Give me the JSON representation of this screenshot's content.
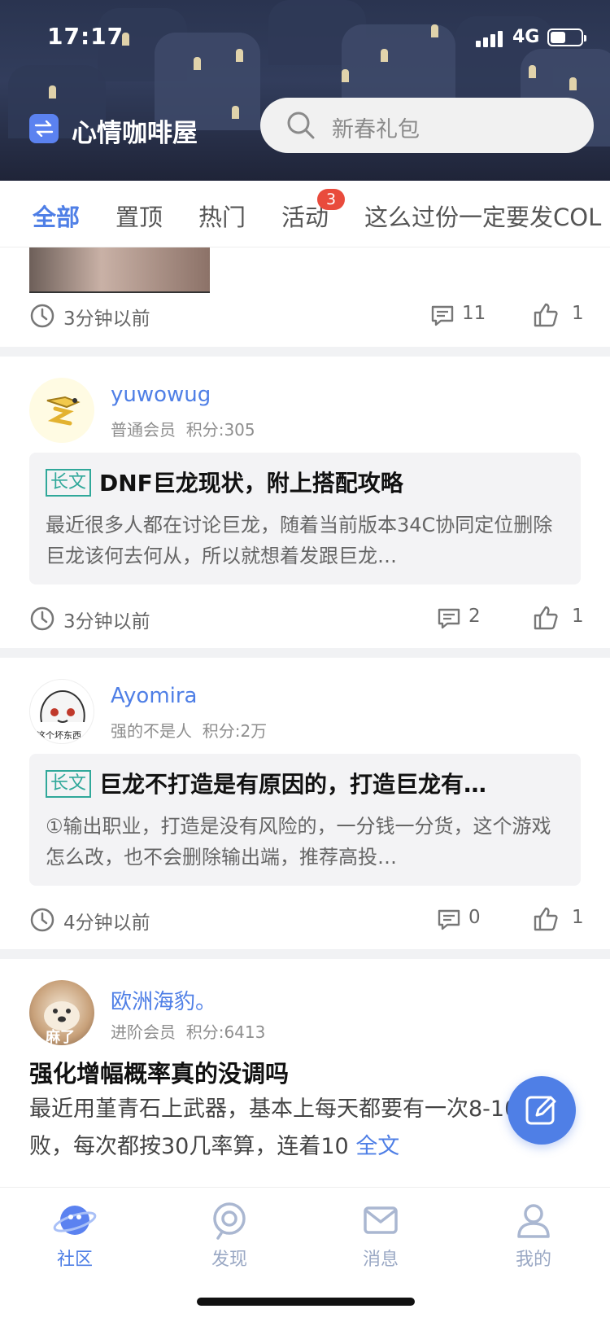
{
  "status_bar": {
    "time": "17:17",
    "network": "4G"
  },
  "header": {
    "app_title": "心情咖啡屋",
    "search_placeholder": "新春礼包",
    "logo_icon": "swap-arrows-icon"
  },
  "tabs": [
    {
      "label": "全部",
      "active": true
    },
    {
      "label": "置顶"
    },
    {
      "label": "热门"
    },
    {
      "label": "活动",
      "badge": "3"
    },
    {
      "label": "这么过份一定要发COL"
    }
  ],
  "posts": [
    {
      "time": "3分钟以前",
      "comments": "11",
      "likes": "1"
    },
    {
      "username": "yuwowug",
      "rank": "普通会员",
      "points": "积分:305",
      "tag": "长文",
      "title": "DNF巨龙现状，附上搭配攻略",
      "body": "最近很多人都在讨论巨龙，随着当前版本34C协同定位删除巨龙该何去何从，所以就想着发跟巨龙…",
      "time": "3分钟以前",
      "comments": "2",
      "likes": "1"
    },
    {
      "username": "Ayomira",
      "rank": "强的不是人",
      "points": "积分:2万",
      "avatar_caption": "这个坏东西",
      "tag": "长文",
      "title": "巨龙不打造是有原因的，打造巨龙有…",
      "body": "①输出职业，打造是没有风险的，一分钱一分货，这个游戏怎么改，也不会删除输出端，推荐高投…",
      "time": "4分钟以前",
      "comments": "0",
      "likes": "1"
    },
    {
      "username": "欧洲海豹。",
      "rank": "进阶会员",
      "points": "积分:6413",
      "avatar_caption": "麻了",
      "title": "强化增幅概率真的没调吗",
      "body": "最近用堇青石上武器，基本上每天都要有一次8-10连败，每次都按30几率算，连着10",
      "more": "全文"
    }
  ],
  "bottom_nav": [
    {
      "label": "社区",
      "icon": "community-planet-icon",
      "active": true
    },
    {
      "label": "发现",
      "icon": "discover-icon"
    },
    {
      "label": "消息",
      "icon": "message-envelope-icon"
    },
    {
      "label": "我的",
      "icon": "profile-icon"
    }
  ],
  "colors": {
    "accent": "#4f7fe6",
    "tag": "#30a89a",
    "badge": "#e94b3c"
  }
}
